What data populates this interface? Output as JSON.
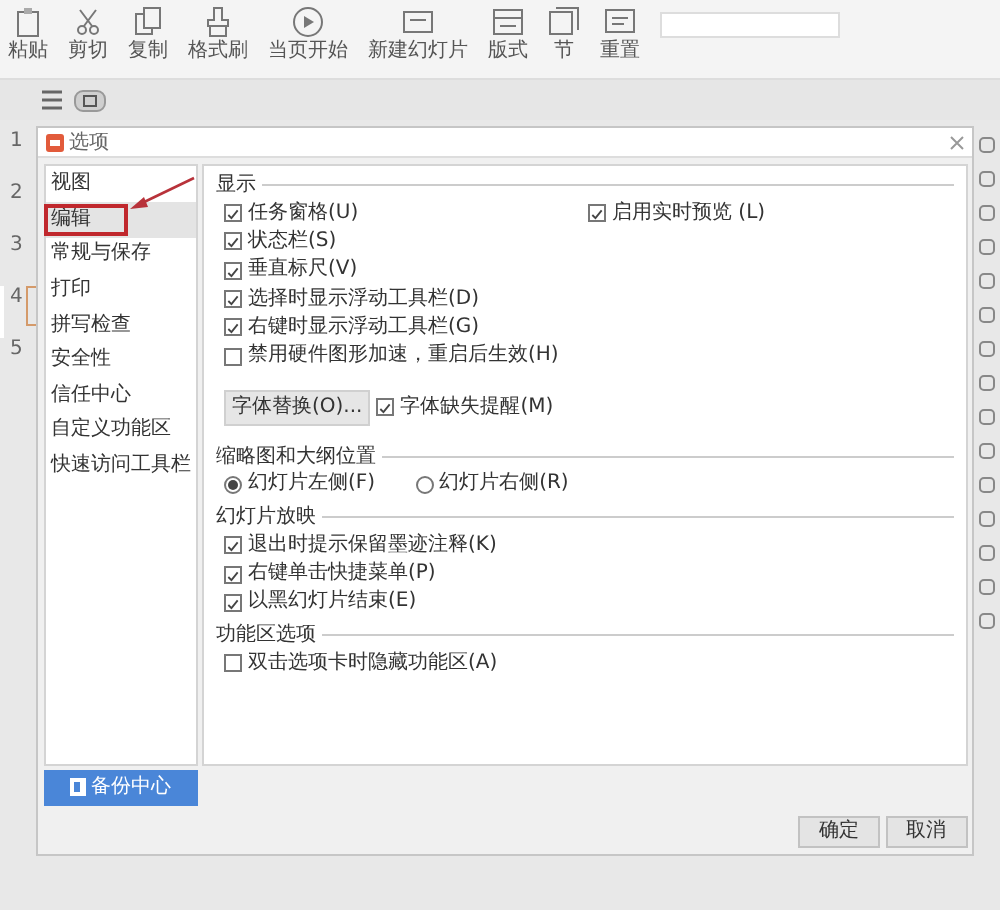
{
  "toolbar": {
    "items": [
      {
        "label": "粘贴"
      },
      {
        "label": "剪切"
      },
      {
        "label": "复制"
      },
      {
        "label": "格式刷"
      },
      {
        "label": "当页开始"
      },
      {
        "label": "新建幻灯片"
      },
      {
        "label": "版式"
      },
      {
        "label": "节"
      },
      {
        "label": "重置"
      }
    ]
  },
  "slides": [
    {
      "number": "1",
      "selected": false
    },
    {
      "number": "2",
      "selected": false
    },
    {
      "number": "3",
      "selected": false
    },
    {
      "number": "4",
      "selected": true
    },
    {
      "number": "5",
      "selected": false
    }
  ],
  "dialog": {
    "title": "选项",
    "sidebar": [
      {
        "label": "视图",
        "selected": false
      },
      {
        "label": "编辑",
        "selected": true
      },
      {
        "label": "常规与保存",
        "selected": false
      },
      {
        "label": "打印",
        "selected": false
      },
      {
        "label": "拼写检查",
        "selected": false
      },
      {
        "label": "安全性",
        "selected": false
      },
      {
        "label": "信任中心",
        "selected": false
      },
      {
        "label": "自定义功能区",
        "selected": false
      },
      {
        "label": "快速访问工具栏",
        "selected": false
      }
    ],
    "backup_button": "备份中心",
    "groups": [
      {
        "title": "显示",
        "rows": [
          [
            {
              "kind": "checkbox",
              "label": "任务窗格(U)",
              "checked": true
            },
            {
              "kind": "checkbox",
              "label": "启用实时预览 (L)",
              "checked": true
            }
          ],
          [
            {
              "kind": "checkbox",
              "label": "状态栏(S)",
              "checked": true
            }
          ],
          [
            {
              "kind": "checkbox",
              "label": "垂直标尺(V)",
              "checked": true
            }
          ],
          [
            {
              "kind": "checkbox",
              "label": "选择时显示浮动工具栏(D)",
              "checked": true
            }
          ],
          [
            {
              "kind": "checkbox",
              "label": "右键时显示浮动工具栏(G)",
              "checked": true
            }
          ],
          [
            {
              "kind": "checkbox",
              "label": "禁用硬件图形加速，重启后生效(H)",
              "checked": false
            }
          ],
          [
            {
              "kind": "button",
              "label": "字体替换(O)..."
            },
            {
              "kind": "checkbox",
              "label": "字体缺失提醒(M)",
              "checked": true
            }
          ]
        ]
      },
      {
        "title": "缩略图和大纲位置",
        "rows": [
          [
            {
              "kind": "radio",
              "label": "幻灯片左侧(F)",
              "selected": true
            },
            {
              "kind": "radio",
              "label": "幻灯片右侧(R)",
              "selected": false
            }
          ]
        ]
      },
      {
        "title": "幻灯片放映",
        "rows": [
          [
            {
              "kind": "checkbox",
              "label": "退出时提示保留墨迹注释(K)",
              "checked": true
            }
          ],
          [
            {
              "kind": "checkbox",
              "label": "右键单击快捷菜单(P)",
              "checked": true
            }
          ],
          [
            {
              "kind": "checkbox",
              "label": "以黑幻灯片结束(E)",
              "checked": true
            }
          ]
        ]
      },
      {
        "title": "功能区选项",
        "rows": [
          [
            {
              "kind": "checkbox",
              "label": "双击选项卡时隐藏功能区(A)",
              "checked": false
            }
          ]
        ]
      }
    ],
    "buttons": [
      "确定",
      "取消"
    ]
  }
}
